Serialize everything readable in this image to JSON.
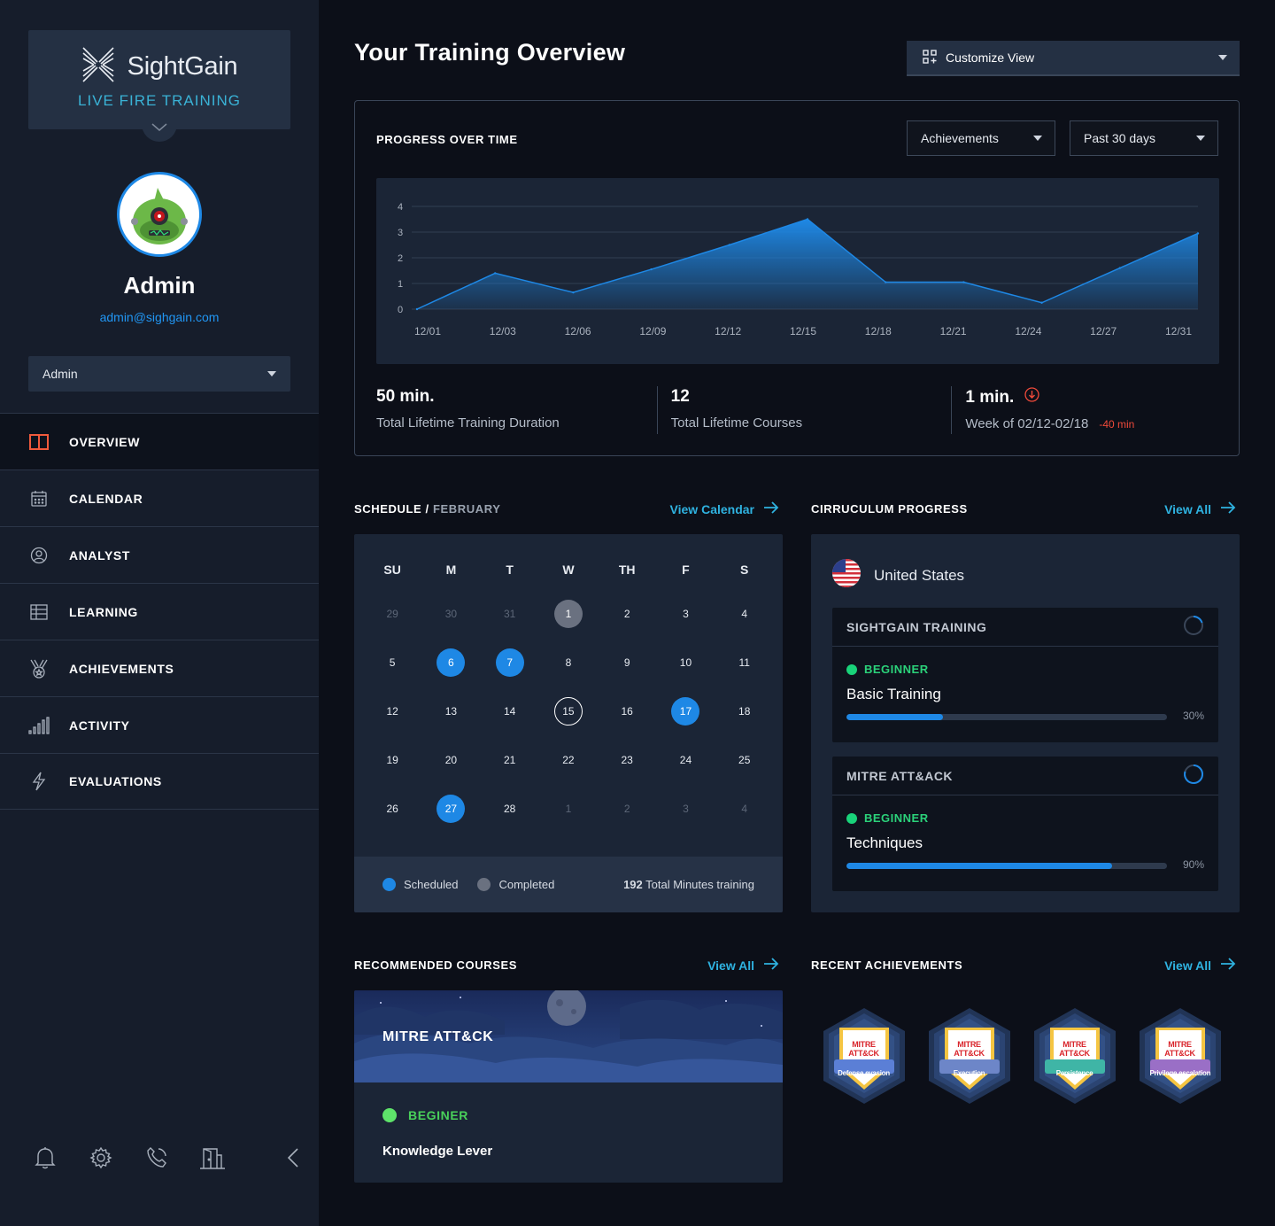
{
  "brand": {
    "name": "SightGain",
    "tagline": "LIVE FIRE TRAINING"
  },
  "user": {
    "name": "Admin",
    "email": "admin@sighgain.com",
    "role": "Admin"
  },
  "nav": [
    {
      "label": "OVERVIEW",
      "icon": "overview-icon",
      "active": true
    },
    {
      "label": "CALENDAR",
      "icon": "calendar-icon"
    },
    {
      "label": "ANALYST",
      "icon": "user-circle-icon"
    },
    {
      "label": "LEARNING",
      "icon": "table-icon"
    },
    {
      "label": "ACHIEVEMENTS",
      "icon": "medal-icon"
    },
    {
      "label": "ACTIVITY",
      "icon": "signal-bars-icon"
    },
    {
      "label": "EVALUATIONS",
      "icon": "bolt-icon"
    }
  ],
  "footer_icons": [
    "bell-icon",
    "gear-icon",
    "phone-icon",
    "door-icon",
    "chevron-left-icon"
  ],
  "page": {
    "title": "Your Training Overview",
    "customize_label": "Customize View"
  },
  "progress": {
    "heading": "PROGRESS OVER TIME",
    "metric_select": "Achievements",
    "range_select": "Past 30 days",
    "stats": [
      {
        "value": "50 min.",
        "label": "Total Lifetime Training Duration"
      },
      {
        "value": "12",
        "label": "Total Lifetime Courses"
      },
      {
        "value": "1 min.",
        "label": "Week of 02/12-02/18",
        "delta": "-40 min"
      }
    ]
  },
  "chart_data": {
    "type": "area",
    "x": [
      "12/01",
      "12/03",
      "12/06",
      "12/09",
      "12/12",
      "12/15",
      "12/18",
      "12/21",
      "12/24",
      "12/27",
      "12/31"
    ],
    "points": [
      {
        "x": "12/01",
        "y": 0
      },
      {
        "x": "12/03",
        "y": 1.4
      },
      {
        "x": "12/06",
        "y": 0.65
      },
      {
        "x": "12/09",
        "y": 1.55
      },
      {
        "x": "12/12",
        "y": 2.5
      },
      {
        "x": "12/15",
        "y": 3.5
      },
      {
        "x": "12/18",
        "y": 1.05
      },
      {
        "x": "12/21",
        "y": 1.05
      },
      {
        "x": "12/24",
        "y": 0.25
      },
      {
        "x": "12/27",
        "y": 1.6
      },
      {
        "x": "12/31",
        "y": 2.95
      }
    ],
    "yticks": [
      0,
      1,
      2,
      3,
      4
    ],
    "ylim": [
      0,
      4
    ],
    "grid": true,
    "color": "#1e88e5"
  },
  "schedule": {
    "heading": "SCHEDULE",
    "month": "FEBRUARY",
    "link": "View Calendar",
    "weekdays": [
      "SU",
      "M",
      "T",
      "W",
      "TH",
      "F",
      "S"
    ],
    "weeks": [
      [
        {
          "d": "29",
          "s": "muted"
        },
        {
          "d": "30",
          "s": "muted"
        },
        {
          "d": "31",
          "s": "muted"
        },
        {
          "d": "1",
          "s": "done"
        },
        {
          "d": "2"
        },
        {
          "d": "3"
        },
        {
          "d": "4"
        }
      ],
      [
        {
          "d": "5"
        },
        {
          "d": "6",
          "s": "sched"
        },
        {
          "d": "7",
          "s": "sched"
        },
        {
          "d": "8"
        },
        {
          "d": "9"
        },
        {
          "d": "10"
        },
        {
          "d": "11"
        }
      ],
      [
        {
          "d": "12"
        },
        {
          "d": "13"
        },
        {
          "d": "14"
        },
        {
          "d": "15",
          "s": "today"
        },
        {
          "d": "16"
        },
        {
          "d": "17",
          "s": "sched"
        },
        {
          "d": "18"
        }
      ],
      [
        {
          "d": "19"
        },
        {
          "d": "20"
        },
        {
          "d": "21"
        },
        {
          "d": "22"
        },
        {
          "d": "23"
        },
        {
          "d": "24"
        },
        {
          "d": "25"
        }
      ],
      [
        {
          "d": "26"
        },
        {
          "d": "27",
          "s": "sched"
        },
        {
          "d": "28"
        },
        {
          "d": "1",
          "s": "muted"
        },
        {
          "d": "2",
          "s": "muted"
        },
        {
          "d": "3",
          "s": "muted"
        },
        {
          "d": "4",
          "s": "muted"
        }
      ]
    ],
    "legend_scheduled": "Scheduled",
    "legend_completed": "Completed",
    "total_value": "192",
    "total_label": "Total Minutes training"
  },
  "curriculum": {
    "heading": "CIRRUCULUM PROGRESS",
    "link": "View All",
    "country": "United States",
    "tracks": [
      {
        "title": "SIGHTGAIN TRAINING",
        "level": "BEGINNER",
        "course": "Basic Training",
        "progress": 0.3,
        "pct_label": "30%"
      },
      {
        "title": "MITRE ATT&ACK",
        "level": "BEGINNER",
        "course": "Techniques",
        "progress": 0.83,
        "pct_label": "90%"
      }
    ]
  },
  "recommended": {
    "heading": "RECOMMENDED COURSES",
    "link": "View All",
    "course_title": "MITRE ATT&CK",
    "level": "BEGINER",
    "subtitle": "Knowledge Lever"
  },
  "achievements": {
    "heading": "RECENT ACHIEVEMENTS",
    "link": "View All",
    "badges": [
      {
        "logo": "MITRE ATT&CK",
        "label": "Defense evasion",
        "color": "#5b7fd6"
      },
      {
        "logo": "MITRE ATT&CK",
        "label": "Execution",
        "color": "#6d86c8"
      },
      {
        "logo": "MITRE ATT&CK",
        "label": "Persistence",
        "color": "#3fb5a6"
      },
      {
        "logo": "MITRE ATT&CK",
        "label": "Privilege escalation",
        "color": "#9a6fc6"
      }
    ]
  }
}
